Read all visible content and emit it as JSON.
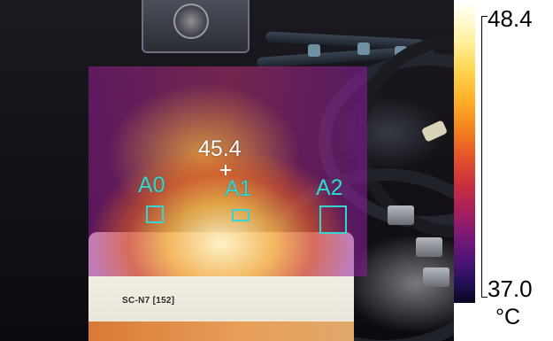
{
  "thermal_image": {
    "spot_temperature": "45.4",
    "markers": [
      {
        "id": "a0",
        "label": "A0"
      },
      {
        "id": "a1",
        "label": "A1"
      },
      {
        "id": "a2",
        "label": "A2"
      }
    ],
    "marker_color": "#37d5d0",
    "plate": {
      "model_text": "SC-N7 [152]"
    }
  },
  "temperature_scale": {
    "max": "48.4",
    "min": "37.0",
    "unit": "°C",
    "palette": "ironbow"
  }
}
